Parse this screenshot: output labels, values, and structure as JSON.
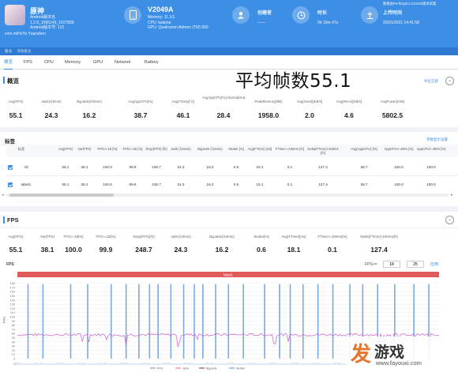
{
  "header": {
    "app": {
      "name": "原神",
      "lines": [
        "Android版本名",
        "1.2.0_1565149_1627898",
        "Android版本号: 131",
        "com.miHoYo.Yuanshen"
      ]
    },
    "device": {
      "model": "V2049A",
      "lines": [
        "Memory: 11.1G",
        "CPU: kalama",
        "GPU: Qualcomm Adreno (TM) 660"
      ]
    },
    "creator": {
      "label": "创建者",
      "value": "——"
    },
    "duration": {
      "label": "时长",
      "value": "0h 19m 47s"
    },
    "upload": {
      "label": "上传时间",
      "value": "20/01/2021 14:41:58",
      "version": "数据由PerfDog5.0.210104版本采集"
    }
  },
  "subbar": {
    "label": "备注:",
    "text": "添加备注"
  },
  "tabs": [
    "概览",
    "FPS",
    "CPU",
    "Memory",
    "GPU",
    "Network",
    "Battery"
  ],
  "overview": {
    "title": "概览",
    "headline": "平均帧数55.1",
    "export": "导出全部",
    "metrics": [
      {
        "label": "Avg(FPS)",
        "value": "55.1"
      },
      {
        "label": "Jank(/10min)",
        "value": "24.3"
      },
      {
        "label": "BigJank(/10min)",
        "value": "16.2"
      },
      {
        "label": "AvgAppCPU[%]",
        "value": "38.7"
      },
      {
        "label": "AvgCTemp[°C]",
        "value": "46.1"
      },
      {
        "label": "AvgAppCPU[%] Normalized",
        "value": "28.4"
      },
      {
        "label": "PeakMemory[MB]",
        "value": "1958.0"
      },
      {
        "label": "Avg(Send)[KB/s]",
        "value": "2.0"
      },
      {
        "label": "Avg(Recv)[KB/s]",
        "value": "4.6"
      },
      {
        "label": "AvgPower[mW]",
        "value": "5802.5"
      }
    ]
  },
  "labels": {
    "title": "标签",
    "link": "参数显示设置",
    "columns": [
      "标签",
      "Avg(FPS)",
      "Var(FPS)",
      "FPS>=18 [%]",
      "FPS>=25 [%]",
      "Drop(FPS) [/h]",
      "Jank (/10min)",
      "BigJank (/10min)",
      "Stutter [%]",
      "Avg(FTime) [ms]",
      "FTime>=100ms [%]",
      "Delta(FTime)>100ms [/h]",
      "Avg(AppCPU) [%]",
      "AppCPU<=60% [%]",
      "AppCPU<=80% [%]"
    ],
    "rows": [
      {
        "name": "All",
        "cells": [
          "55.1",
          "38.1",
          "100.0",
          "99.9",
          "248.7",
          "24.3",
          "16.2",
          "0.6",
          "18.1",
          "0.1",
          "127.4",
          "38.7",
          "100.0",
          "100.0"
        ]
      },
      {
        "name": "label1",
        "cells": [
          "55.1",
          "38.1",
          "100.0",
          "99.9",
          "248.7",
          "24.3",
          "16.2",
          "0.6",
          "18.1",
          "0.1",
          "127.4",
          "38.7",
          "100.0",
          "100.0"
        ]
      }
    ]
  },
  "fps_section": {
    "title": "FPS",
    "metrics": [
      {
        "label": "Avg(FPS)",
        "value": "55.1"
      },
      {
        "label": "Var(FPS)",
        "value": "38.1"
      },
      {
        "label": "FPS>=18[%]",
        "value": "100.0"
      },
      {
        "label": "FPS>=25[%]",
        "value": "99.9"
      },
      {
        "label": "Drop(FPS)[/h]",
        "value": "248.7"
      },
      {
        "label": "Jank(/10min)",
        "value": "24.3"
      },
      {
        "label": "BigJank(/10min)",
        "value": "16.2"
      },
      {
        "label": "Stutter[%]",
        "value": "0.6"
      },
      {
        "label": "Avg(FTime)[ms]",
        "value": "18.1"
      },
      {
        "label": "FTime>=100ms[%]",
        "value": "0.1"
      },
      {
        "label": "Delta(FTime)>100ms[/h]",
        "value": "127.4"
      }
    ],
    "chart_title": "FPS",
    "fps_input_label": "FPS>=",
    "fps_values": [
      "18",
      "25"
    ],
    "apply": "应用"
  },
  "chart_data": {
    "type": "line",
    "label_band": "label1",
    "y_ticks": [
      "180",
      "170",
      "160",
      "150",
      "140",
      "130",
      "120",
      "110",
      "100",
      "90",
      "80",
      "70",
      "60",
      "50",
      "40",
      "30",
      "20",
      "10",
      "0"
    ],
    "ylim": [
      0,
      185
    ],
    "ylabel": "FPS",
    "x_ticks": [
      "00:00",
      "01:00",
      "02:00",
      "03:00",
      "04:00",
      "05:00",
      "06:00",
      "07:00",
      "08:00",
      "09:00",
      "10:00",
      "11:00",
      "12:00",
      "13:00",
      "14:00",
      "15:00",
      "16:00",
      "17:00",
      "18:00",
      "19:00"
    ],
    "xlim_minutes": [
      0,
      19.78
    ],
    "series": [
      {
        "name": "FPS",
        "color": "#c65fcf",
        "typical": 57
      },
      {
        "name": "Jank",
        "color": "#e07070"
      },
      {
        "name": "BigJank",
        "color": "#8b2a2a"
      },
      {
        "name": "Stutter",
        "color": "#4f8fd6"
      }
    ],
    "spikes_at_minutes": [
      0.5,
      1.2,
      2.5,
      3.3,
      4.4,
      5.1,
      5.7,
      6.2,
      6.6,
      7.2,
      7.8,
      8.3,
      8.7,
      9.3,
      9.9,
      10.6,
      11.6,
      12.3,
      12.8,
      13.4,
      14.1,
      14.8,
      15.6,
      16.2,
      16.9,
      17.7,
      18.6,
      19.3
    ]
  },
  "watermark": {
    "text": "游戏",
    "site": "www.fayouxi.com"
  },
  "colors": {
    "header": "#3d8fe6",
    "accent": "#3d8fe6",
    "fps": "#c65fcf",
    "band": "#e05a5a"
  }
}
